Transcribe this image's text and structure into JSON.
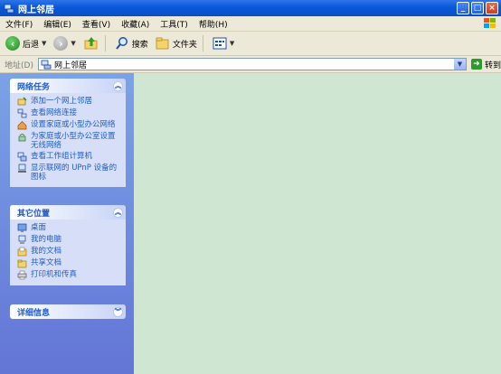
{
  "window": {
    "title": "网上邻居",
    "controls": {
      "minimize": "_",
      "maximize": "□",
      "close": "×"
    }
  },
  "menu": [
    "文件(F)",
    "编辑(E)",
    "查看(V)",
    "收藏(A)",
    "工具(T)",
    "帮助(H)"
  ],
  "toolbar": {
    "back_label": "后退",
    "search_label": "搜索",
    "folders_label": "文件夹"
  },
  "address": {
    "label": "地址(D)",
    "value": "网上邻居",
    "go_label": "转到"
  },
  "panels": {
    "network_tasks": {
      "title": "网络任务",
      "items": [
        "添加一个网上邻居",
        "查看网络连接",
        "设置家庭或小型办公网络",
        "为家庭或小型办公室设置无线网络",
        "查看工作组计算机",
        "显示联网的 UPnP 设备的图标"
      ]
    },
    "other_places": {
      "title": "其它位置",
      "items": [
        "桌面",
        "我的电脑",
        "我的文档",
        "共享文档",
        "打印机和传真"
      ]
    },
    "details": {
      "title": "详细信息"
    }
  },
  "colors": {
    "titlebar": "#0a58d8",
    "sidebar": "#6f8fe0",
    "panel_bg": "#d6dff7",
    "link": "#215dc6",
    "main_bg": "#cfe6d2"
  }
}
